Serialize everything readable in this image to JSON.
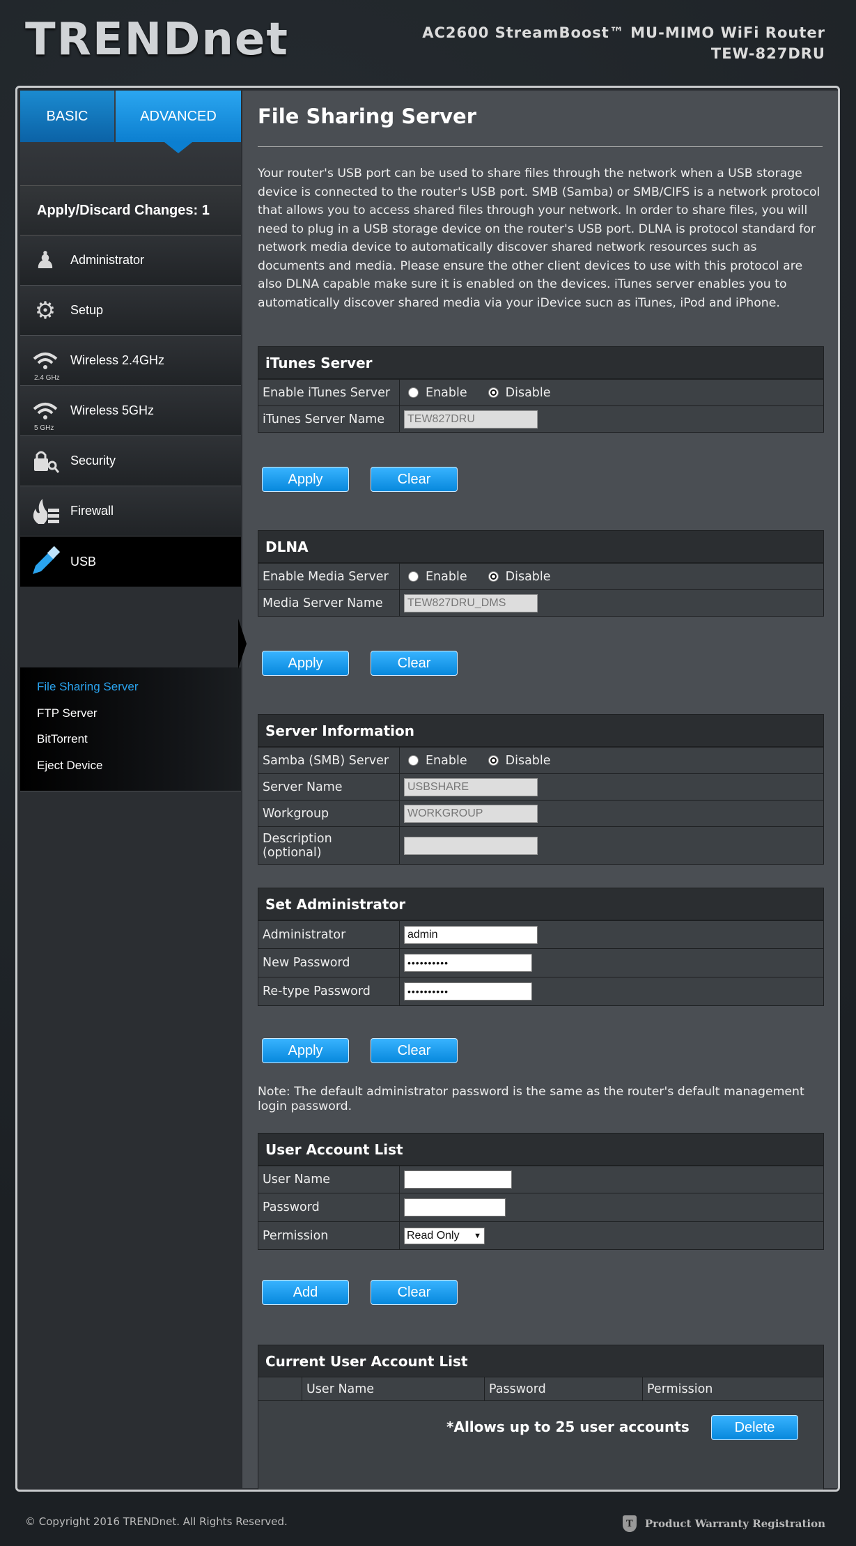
{
  "header": {
    "logo": "TRENDnet",
    "product_line1": "AC2600 StreamBoost™ MU-MIMO WiFi Router",
    "product_line2": "TEW-827DRU"
  },
  "sidebar": {
    "tabs": [
      {
        "label": "BASIC"
      },
      {
        "label": "ADVANCED"
      }
    ],
    "apply_changes": "Apply/Discard Changes: 1",
    "items": [
      {
        "label": "Administrator",
        "icon": "administrator-icon"
      },
      {
        "label": "Setup",
        "icon": "gears-icon"
      },
      {
        "label": "Wireless 2.4GHz",
        "icon": "wifi-icon",
        "badge": "2.4 GHz"
      },
      {
        "label": "Wireless 5GHz",
        "icon": "wifi-icon",
        "badge": "5 GHz"
      },
      {
        "label": "Security",
        "icon": "lock-icon"
      },
      {
        "label": "Firewall",
        "icon": "firewall-icon"
      },
      {
        "label": "USB",
        "icon": "usb-icon"
      }
    ],
    "sub_items": [
      {
        "label": "File Sharing Server"
      },
      {
        "label": "FTP Server"
      },
      {
        "label": "BitTorrent"
      },
      {
        "label": "Eject Device"
      }
    ]
  },
  "main": {
    "title": "File Sharing Server",
    "intro": "Your router's USB port can be used to share files through the network when a USB storage device is connected to the router's USB port. SMB (Samba) or SMB/CIFS is a network protocol that allows you to access shared files through your network. In order to share files, you will need to plug in a USB storage device on the router's USB port. DLNA is protocol standard for network media device to automatically discover shared network resources such as documents and media. Please ensure the other client devices to use with this protocol are also DLNA capable make sure it is enabled on the devices. iTunes server enables you to automatically discover shared media via your iDevice sucn as iTunes, iPod and iPhone.",
    "radio_enable": "Enable",
    "radio_disable": "Disable",
    "apply_label": "Apply",
    "clear_label": "Clear",
    "add_label": "Add",
    "delete_label": "Delete",
    "itunes": {
      "title": "iTunes Server",
      "enable_label": "Enable iTunes Server",
      "name_label": "iTunes Server Name",
      "name_value": "TEW827DRU",
      "selected": "Disable"
    },
    "dlna": {
      "title": "DLNA",
      "enable_label": "Enable Media Server",
      "name_label": "Media Server Name",
      "name_value": "TEW827DRU_DMS",
      "selected": "Disable"
    },
    "server_info": {
      "title": "Server Information",
      "samba_label": "Samba (SMB) Server",
      "selected": "Disable",
      "server_name_label": "Server Name",
      "server_name_value": "USBSHARE",
      "workgroup_label": "Workgroup",
      "workgroup_value": "WORKGROUP",
      "description_label_1": "Description",
      "description_label_2": "(optional)",
      "description_value": ""
    },
    "set_admin": {
      "title": "Set Administrator",
      "admin_label": "Administrator",
      "admin_value": "admin",
      "new_password_label": "New Password",
      "new_password_value": "••••••••••",
      "retype_password_label": "Re-type Password",
      "retype_password_value": "••••••••••"
    },
    "note": "Note: The default administrator password is the same as the router's default management login password.",
    "user_account": {
      "title": "User Account List",
      "username_label": "User Name",
      "password_label": "Password",
      "permission_label": "Permission",
      "permission_value": "Read Only"
    },
    "current_list": {
      "title": "Current User Account List",
      "columns": [
        "",
        "User Name",
        "Password",
        "Permission"
      ],
      "note": "*Allows up to 25 user accounts"
    }
  },
  "footer": {
    "copyright": "© Copyright 2016 TRENDnet. All Rights Reserved.",
    "warranty": "Product Warranty Registration"
  }
}
